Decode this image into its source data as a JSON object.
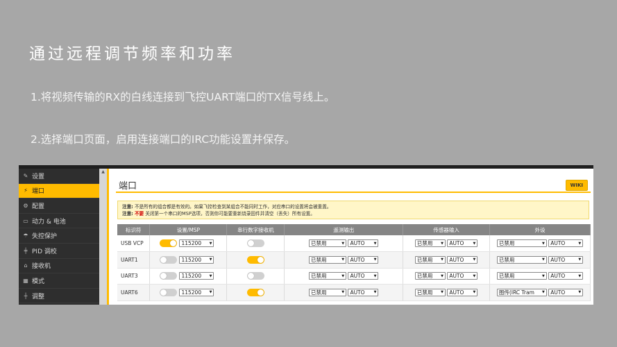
{
  "slide": {
    "title": "通过远程调节频率和功率",
    "step1": "1.将视频传输的RX的白线连接到飞控UART端口的TX信号线上。",
    "step2": "2.选择端口页面，启用连接端口的IRC功能设置并保存。"
  },
  "sidebar": {
    "items": [
      {
        "label": "设置",
        "icon": "wrench-icon"
      },
      {
        "label": "端口",
        "icon": "plug-icon",
        "active": true
      },
      {
        "label": "配置",
        "icon": "gear-icon"
      },
      {
        "label": "动力 & 电池",
        "icon": "battery-icon"
      },
      {
        "label": "失控保护",
        "icon": "parachute-icon"
      },
      {
        "label": "PID 调校",
        "icon": "sliders-icon"
      },
      {
        "label": "接收机",
        "icon": "receiver-icon"
      },
      {
        "label": "模式",
        "icon": "modes-icon"
      },
      {
        "label": "调整",
        "icon": "adjust-icon"
      }
    ]
  },
  "main": {
    "title": "端口",
    "wiki_label": "WIKI",
    "notice": {
      "line1_key": "注意:",
      "line1_text": "不是所有的组合都是有效的。如果飞控检查到某组合不能同时工作，对应串口的设置将会被重置。",
      "line2_key": "注意:",
      "line2_warn": "不要",
      "line2_text": "关闭第一个串口的MSP选项，否则你可能要重新烧录固件并清空（丢失）所有设置。"
    },
    "table": {
      "headers": [
        "标识符",
        "设置/MSP",
        "串行数字接收机",
        "遥测输出",
        "传感器输入",
        "外设"
      ],
      "rows": [
        {
          "id": "USB VCP",
          "msp_on": true,
          "baud": "115200",
          "rx_on": false,
          "tel": "已禁用",
          "tel_auto": "AUTO",
          "sens": "已禁用",
          "sens_auto": "AUTO",
          "per": "已禁用",
          "per_auto": "AUTO"
        },
        {
          "id": "UART1",
          "msp_on": false,
          "baud": "115200",
          "rx_on": true,
          "tel": "已禁用",
          "tel_auto": "AUTO",
          "sens": "已禁用",
          "sens_auto": "AUTO",
          "per": "已禁用",
          "per_auto": "AUTO"
        },
        {
          "id": "UART3",
          "msp_on": false,
          "baud": "115200",
          "rx_on": false,
          "tel": "已禁用",
          "tel_auto": "AUTO",
          "sens": "已禁用",
          "sens_auto": "AUTO",
          "per": "已禁用",
          "per_auto": "AUTO"
        },
        {
          "id": "UART6",
          "msp_on": false,
          "baud": "115200",
          "rx_on": true,
          "tel": "已禁用",
          "tel_auto": "AUTO",
          "sens": "已禁用",
          "sens_auto": "AUTO",
          "per": "图传(IRC Tram",
          "per_auto": "AUTO"
        }
      ]
    }
  },
  "colors": {
    "accent": "#ffbb00",
    "sidebar_bg": "#2e2e2e",
    "slide_bg": "#a7a7a7"
  }
}
